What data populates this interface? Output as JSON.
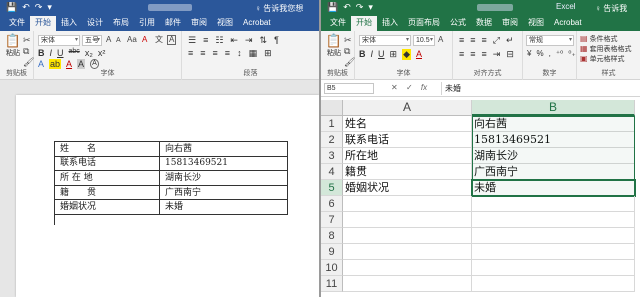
{
  "word": {
    "qat": {
      "save": "💾",
      "undo": "↶",
      "redo": "↷",
      "more": "▾"
    },
    "tabs": [
      "文件",
      "开始",
      "插入",
      "设计",
      "布局",
      "引用",
      "邮件",
      "审阅",
      "视图",
      "Acrobat"
    ],
    "active_tab": "开始",
    "tellme": "♀ 告诉我您想",
    "ribbon": {
      "paste_label": "粘贴",
      "clipboard_group": "剪贴板",
      "font_name": "宋体",
      "font_size": "五号",
      "font_group": "字体",
      "para_group": "段落",
      "format_row": {
        "bold": "B",
        "italic": "I",
        "underline": "U",
        "strike": "abc",
        "sub": "x₂",
        "sup": "x²"
      },
      "color_row": {
        "effects": "A",
        "highlight": "ab",
        "font_color": "A",
        "aa": "Aa",
        "grow": "A",
        "shade": "A",
        "border_a": "A"
      }
    },
    "table": [
      [
        "姓　　名",
        "向右茜"
      ],
      [
        "联系电话",
        "15813469521"
      ],
      [
        "所 在 地",
        "湖南长沙"
      ],
      [
        "籍　　贯",
        "广西南宁"
      ],
      [
        "婚姻状况",
        "未婚"
      ]
    ]
  },
  "excel": {
    "qat": {
      "save": "💾",
      "undo": "↶",
      "redo": "↷",
      "more": "▾"
    },
    "title": "Excel",
    "tabs": [
      "文件",
      "开始",
      "插入",
      "页面布局",
      "公式",
      "数据",
      "审阅",
      "视图",
      "Acrobat"
    ],
    "active_tab": "开始",
    "tellme": "♀ 告诉我",
    "ribbon": {
      "paste_label": "粘贴",
      "clipboard_group": "剪贴板",
      "font_name": "宋体",
      "font_size": "10.5",
      "font_group": "字体",
      "align_group": "对齐方式",
      "number_format": "常规",
      "number_group": "数字",
      "styles": [
        "条件格式",
        "套用表格格式",
        "单元格样式"
      ],
      "styles_group": "样式",
      "format_row": {
        "bold": "B",
        "italic": "I",
        "underline": "U"
      }
    },
    "namebox": "B5",
    "fx_buttons": {
      "cancel": "✕",
      "enter": "✓",
      "fx": "fx"
    },
    "formula_value": "未婚",
    "columns": [
      "A",
      "B"
    ],
    "selected_column": "B",
    "rows": [
      "1",
      "2",
      "3",
      "4",
      "5",
      "6",
      "7",
      "8",
      "9",
      "10",
      "11"
    ],
    "selected_row": "5",
    "cells": [
      [
        "姓名",
        "向右茜"
      ],
      [
        "联系电话",
        "15813469521"
      ],
      [
        "所在地",
        "湖南长沙"
      ],
      [
        "籍贯",
        "广西南宁"
      ],
      [
        "婚姻状况",
        "未婚"
      ]
    ],
    "selected_cell": "B5"
  }
}
